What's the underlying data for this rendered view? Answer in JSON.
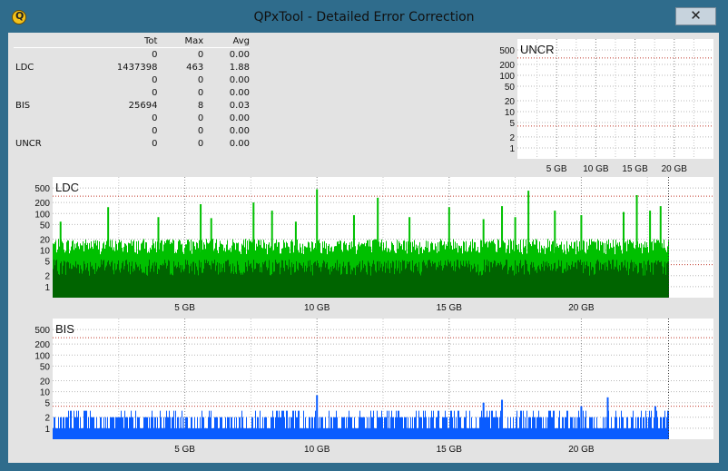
{
  "window": {
    "title": "QPxTool - Detailed Error Correction",
    "close_glyph": "✕",
    "icon": "qpxtool-app-icon",
    "icon_letter": "Q"
  },
  "stats": {
    "headers": [
      "",
      "Tot",
      "Max",
      "Avg"
    ],
    "rows": [
      [
        "",
        "0",
        "0",
        "0.00"
      ],
      [
        "LDC",
        "1437398",
        "463",
        "1.88"
      ],
      [
        "",
        "0",
        "0",
        "0.00"
      ],
      [
        "",
        "0",
        "0",
        "0.00"
      ],
      [
        "BIS",
        "25694",
        "8",
        "0.03"
      ],
      [
        "",
        "0",
        "0",
        "0.00"
      ],
      [
        "",
        "0",
        "0",
        "0.00"
      ],
      [
        "UNCR",
        "0",
        "0",
        "0.00"
      ]
    ]
  },
  "colors": {
    "ldc_light": "#00c000",
    "ldc_dark": "#006400",
    "bis": "#0a5cff",
    "threshold": "#c0392b"
  },
  "chart_data": [
    {
      "type": "bar",
      "title": "UNCR",
      "y_scale": "log",
      "y_ticks": [
        "500",
        "200",
        "100",
        "50",
        "20",
        "10",
        "5",
        "2",
        "1"
      ],
      "x_ticks": [
        "5 GB",
        "10 GB",
        "15 GB",
        "20 GB"
      ],
      "x_range": [
        0,
        25
      ],
      "values": [],
      "grid": true
    },
    {
      "type": "bar",
      "title": "LDC",
      "y_scale": "log",
      "y_ticks": [
        "500",
        "200",
        "100",
        "50",
        "20",
        "10",
        "5",
        "2",
        "1"
      ],
      "x_ticks": [
        "5 GB",
        "10 GB",
        "15 GB",
        "20 GB"
      ],
      "x_range": [
        0,
        25
      ],
      "data_end_gb": 23.3,
      "typical_level": 14,
      "max": 463,
      "spikes": [
        [
          0.3,
          60
        ],
        [
          2.1,
          150
        ],
        [
          4.0,
          80
        ],
        [
          5.6,
          180
        ],
        [
          6.0,
          75
        ],
        [
          7.6,
          200
        ],
        [
          8.3,
          120
        ],
        [
          9.2,
          60
        ],
        [
          10.0,
          463
        ],
        [
          11.4,
          90
        ],
        [
          12.3,
          270
        ],
        [
          13.5,
          80
        ],
        [
          15.0,
          150
        ],
        [
          16.3,
          70
        ],
        [
          17.0,
          160
        ],
        [
          17.5,
          80
        ],
        [
          18.0,
          420
        ],
        [
          19.0,
          120
        ],
        [
          20.0,
          90
        ],
        [
          21.6,
          110
        ],
        [
          22.1,
          320
        ],
        [
          22.6,
          120
        ],
        [
          23.0,
          160
        ]
      ],
      "grid": true
    },
    {
      "type": "bar",
      "title": "BIS",
      "y_scale": "log",
      "y_ticks": [
        "500",
        "200",
        "100",
        "50",
        "20",
        "10",
        "5",
        "2",
        "1"
      ],
      "x_ticks": [
        "5 GB",
        "10 GB",
        "15 GB",
        "20 GB"
      ],
      "x_range": [
        0,
        25
      ],
      "data_end_gb": 23.3,
      "max": 8,
      "spikes": [
        [
          10.0,
          8
        ],
        [
          16.3,
          5
        ],
        [
          17.0,
          6
        ],
        [
          20.0,
          4
        ],
        [
          21.0,
          7
        ],
        [
          22.8,
          4
        ]
      ],
      "grid": true
    }
  ]
}
